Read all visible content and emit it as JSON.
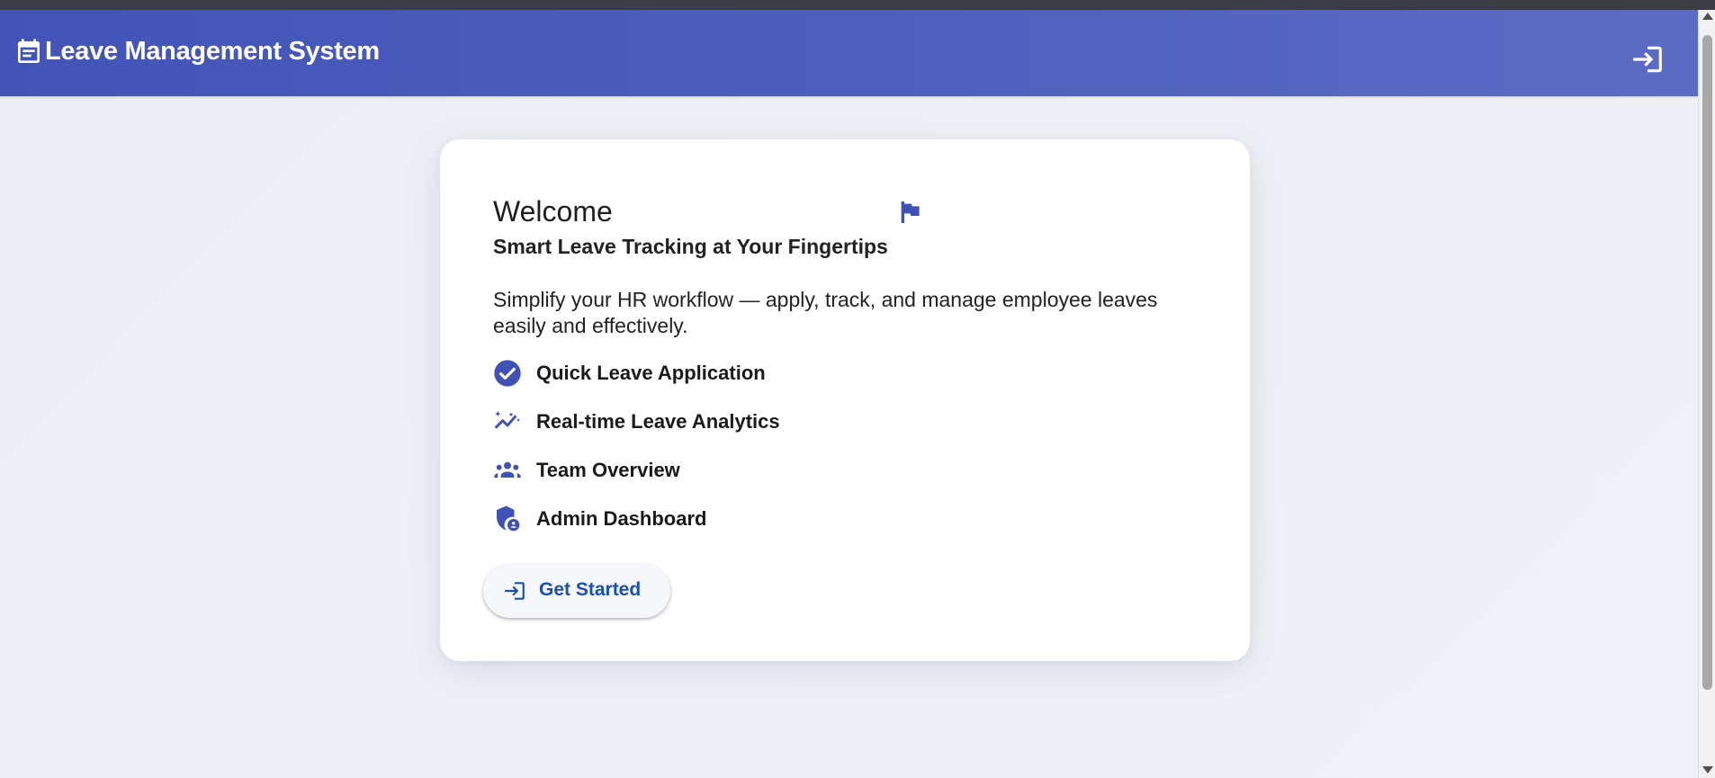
{
  "app": {
    "title": "Leave Management System",
    "icons": {
      "brand": "calendar-icon",
      "login": "login-icon"
    },
    "colors": {
      "appbar_start": "#4354b8",
      "appbar_end": "#5c6cc4",
      "accent": "#3f51b5",
      "cta_text": "#1a4fb0"
    }
  },
  "card": {
    "heading": "Welcome",
    "heading_icon": "flag-icon",
    "subtitle": "Smart Leave Tracking at Your Fingertips",
    "description": "Simplify your HR workflow — apply, track, and manage employee leaves easily and effectively.",
    "features": [
      {
        "label": "Quick Leave Application",
        "icon": "check-circle-icon"
      },
      {
        "label": "Real-time Leave Analytics",
        "icon": "analytics-icon"
      },
      {
        "label": "Team Overview",
        "icon": "groups-icon"
      },
      {
        "label": "Admin Dashboard",
        "icon": "admin-shield-icon"
      }
    ],
    "cta": {
      "label": "Get Started",
      "icon": "login-icon"
    }
  }
}
